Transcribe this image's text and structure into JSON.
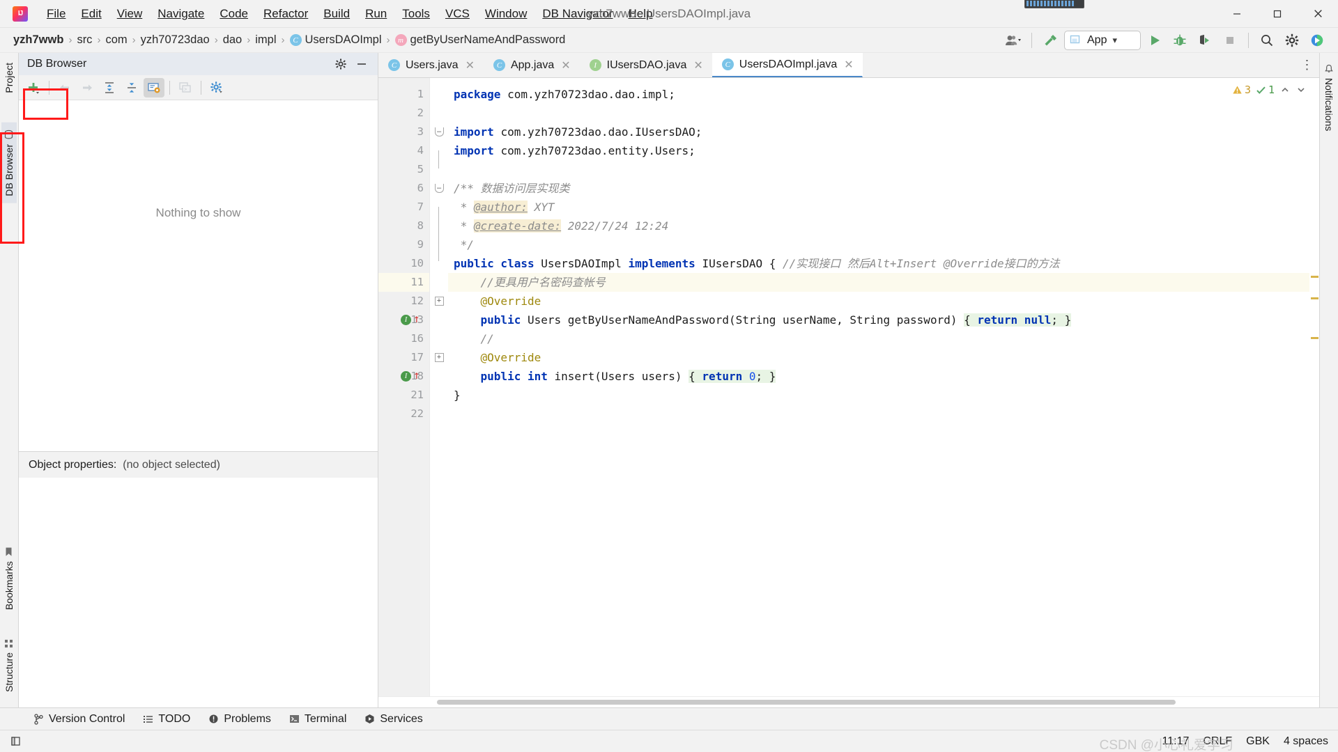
{
  "window": {
    "title": "yzh7wwb - UsersDAOImpl.java",
    "logo_text": "IJ",
    "minimize": "─",
    "maximize": "❐",
    "close": "✕"
  },
  "menu": {
    "items": [
      {
        "label": "File",
        "mnemonic": "F"
      },
      {
        "label": "Edit",
        "mnemonic": "E"
      },
      {
        "label": "View",
        "mnemonic": "V"
      },
      {
        "label": "Navigate",
        "mnemonic": "N"
      },
      {
        "label": "Code",
        "mnemonic": "C"
      },
      {
        "label": "Refactor",
        "mnemonic": "R"
      },
      {
        "label": "Build",
        "mnemonic": "B"
      },
      {
        "label": "Run",
        "mnemonic": "u"
      },
      {
        "label": "Tools",
        "mnemonic": "T"
      },
      {
        "label": "VCS",
        "mnemonic": "S"
      },
      {
        "label": "Window",
        "mnemonic": "W"
      },
      {
        "label": "DB Navigator",
        "mnemonic": "D"
      },
      {
        "label": "Help",
        "mnemonic": "H"
      }
    ]
  },
  "navbar": {
    "crumbs": [
      {
        "label": "yzh7wwb",
        "badge": ""
      },
      {
        "label": "src",
        "badge": ""
      },
      {
        "label": "com",
        "badge": ""
      },
      {
        "label": "yzh70723dao",
        "badge": ""
      },
      {
        "label": "dao",
        "badge": ""
      },
      {
        "label": "impl",
        "badge": ""
      },
      {
        "label": "UsersDAOImpl",
        "badge": "C"
      },
      {
        "label": "getByUserNameAndPassword",
        "badge": "m"
      }
    ],
    "separator": "›",
    "run_config": "App",
    "dropdown_caret": "▾"
  },
  "toolbar_right": {
    "buttons": [
      {
        "name": "user-account-icon",
        "label": "account"
      },
      {
        "name": "build-hammer-icon",
        "label": "build"
      },
      {
        "name": "run-icon",
        "label": "run"
      },
      {
        "name": "debug-icon",
        "label": "debug"
      },
      {
        "name": "run-coverage-icon",
        "label": "run with coverage"
      },
      {
        "name": "stop-icon",
        "label": "stop"
      },
      {
        "name": "search-everywhere-icon",
        "label": "search everywhere"
      },
      {
        "name": "settings-gear-icon",
        "label": "settings"
      },
      {
        "name": "ide-assistant-icon",
        "label": "assistant"
      }
    ]
  },
  "left_rail": {
    "top_label": "Project",
    "db_browser_label": "DB Browser",
    "bookmarks_label": "Bookmarks",
    "structure_label": "Structure"
  },
  "right_rail": {
    "notifications_label": "Notifications"
  },
  "db_browser": {
    "title": "DB Browser",
    "toolbar": [
      {
        "name": "add-connection-icon",
        "label": "New connection",
        "state": "enabled"
      },
      {
        "name": "back-arrow-icon",
        "label": "Back",
        "state": "disabled"
      },
      {
        "name": "forward-arrow-icon",
        "label": "Forward",
        "state": "disabled"
      },
      {
        "name": "expand-all-icon",
        "label": "Expand all",
        "state": "enabled"
      },
      {
        "name": "collapse-all-icon",
        "label": "Collapse all",
        "state": "enabled"
      },
      {
        "name": "show-object-properties-icon",
        "label": "Object properties",
        "state": "selected"
      },
      {
        "name": "open-sql-console-icon",
        "label": "SQL console",
        "state": "disabled"
      },
      {
        "name": "db-settings-icon",
        "label": "Settings",
        "state": "enabled"
      }
    ],
    "empty_text": "Nothing to show",
    "object_properties_label": "Object properties:",
    "object_properties_value": "(no object selected)",
    "settings_icon": "gear-icon",
    "hide_icon": "minimize-icon"
  },
  "editor": {
    "tabs": [
      {
        "label": "Users.java",
        "badge": "C",
        "badge_type": "c",
        "active": false
      },
      {
        "label": "App.java",
        "badge": "C",
        "badge_type": "c-run",
        "active": false
      },
      {
        "label": "IUsersDAO.java",
        "badge": "I",
        "badge_type": "i",
        "active": false
      },
      {
        "label": "UsersDAOImpl.java",
        "badge": "C",
        "badge_type": "c",
        "active": true
      }
    ],
    "tab_close": "✕",
    "tabs_more": "⋮",
    "inspection": {
      "warning_count": "3",
      "ok_count": "1",
      "warning_icon": "warning-triangle-icon",
      "ok_icon": "checkmark-icon",
      "up_chevron": "⌃",
      "down_chevron": "⌄"
    },
    "lines": [
      {
        "num": "1",
        "tokens": [
          {
            "t": "package ",
            "c": "kw"
          },
          {
            "t": "com.yzh70723dao.dao.impl;",
            "c": "pl"
          }
        ]
      },
      {
        "num": "2",
        "tokens": []
      },
      {
        "num": "3",
        "tokens": [
          {
            "t": "import ",
            "c": "kw"
          },
          {
            "t": "com.yzh70723dao.dao.IUsersDAO;",
            "c": "pl"
          }
        ],
        "fold": "minus"
      },
      {
        "num": "4",
        "tokens": [
          {
            "t": "import ",
            "c": "kw"
          },
          {
            "t": "com.yzh70723dao.entity.Users;",
            "c": "pl"
          }
        ],
        "fold": "bar"
      },
      {
        "num": "5",
        "tokens": []
      },
      {
        "num": "6",
        "tokens": [
          {
            "t": "/** 数据访问层实现类",
            "c": "doc"
          }
        ],
        "fold": "minus"
      },
      {
        "num": "7",
        "tokens": [
          {
            "t": " * ",
            "c": "doc"
          },
          {
            "t": "@author:",
            "c": "tag"
          },
          {
            "t": " XYT",
            "c": "doc"
          }
        ],
        "fold": "bar"
      },
      {
        "num": "8",
        "tokens": [
          {
            "t": " * ",
            "c": "doc"
          },
          {
            "t": "@create-date:",
            "c": "tag"
          },
          {
            "t": " 2022/7/24 12:24",
            "c": "doc"
          }
        ],
        "fold": "bar"
      },
      {
        "num": "9",
        "tokens": [
          {
            "t": " */",
            "c": "doc"
          }
        ],
        "fold": "end"
      },
      {
        "num": "10",
        "tokens": [
          {
            "t": "public class ",
            "c": "kw"
          },
          {
            "t": "UsersDAOImpl ",
            "c": "pl"
          },
          {
            "t": "implements ",
            "c": "kw"
          },
          {
            "t": "IUsersDAO { ",
            "c": "pl"
          },
          {
            "t": "//实现接口 然后Alt+Insert @Override接口的方法",
            "c": "cm"
          }
        ]
      },
      {
        "num": "11",
        "current": true,
        "tokens": [
          {
            "t": "    //更具用户名密码查帐号",
            "c": "cm"
          }
        ]
      },
      {
        "num": "12",
        "tokens": [
          {
            "t": "    @Override",
            "c": "ann"
          }
        ]
      },
      {
        "num": "13",
        "run_marker": true,
        "fold": "plus",
        "tokens": [
          {
            "t": "    public ",
            "c": "kw"
          },
          {
            "t": "Users getByUserNameAndPassword(String userName, String password) ",
            "c": "pl"
          },
          {
            "t": "{ ",
            "c": "hl"
          },
          {
            "t": "return null",
            "c": "kwhl"
          },
          {
            "t": "; }",
            "c": "hl"
          }
        ]
      },
      {
        "num": "16",
        "tokens": [
          {
            "t": "    //",
            "c": "cm"
          }
        ]
      },
      {
        "num": "17",
        "tokens": [
          {
            "t": "    @Override",
            "c": "ann"
          }
        ]
      },
      {
        "num": "18",
        "run_marker": true,
        "fold": "plus",
        "tokens": [
          {
            "t": "    public int ",
            "c": "kw"
          },
          {
            "t": "insert(Users users) ",
            "c": "pl"
          },
          {
            "t": "{ ",
            "c": "hl"
          },
          {
            "t": "return 0",
            "c": "kwhl-num"
          },
          {
            "t": "; }",
            "c": "hl"
          }
        ]
      },
      {
        "num": "21",
        "tokens": [
          {
            "t": "}",
            "c": "pl"
          }
        ]
      },
      {
        "num": "22",
        "tokens": []
      }
    ]
  },
  "bottom_bar": {
    "items": [
      {
        "label": "Version Control",
        "icon": "branch-icon"
      },
      {
        "label": "TODO",
        "icon": "list-icon"
      },
      {
        "label": "Problems",
        "icon": "exclamation-circle-icon"
      },
      {
        "label": "Terminal",
        "icon": "terminal-icon"
      },
      {
        "label": "Services",
        "icon": "services-icon"
      }
    ]
  },
  "status_bar": {
    "left_icon": "show-tool-windows-icon",
    "caret_position": "11:17",
    "line_separator": "CRLF",
    "encoding": "GBK",
    "indent": "4 spaces",
    "watermark": "CSDN @小心礼爱学习"
  },
  "colors": {
    "accent_blue": "#4a88c7",
    "keyword": "#0033b3",
    "comment": "#8c8c8c",
    "annotation": "#9e880d",
    "annotation_highlight": "#f7eed4",
    "current_line": "#fcfaed",
    "toolwindow_header": "#e6eaf0",
    "annotation_box": "#ff1a1a",
    "green": "#4a9a4a"
  }
}
